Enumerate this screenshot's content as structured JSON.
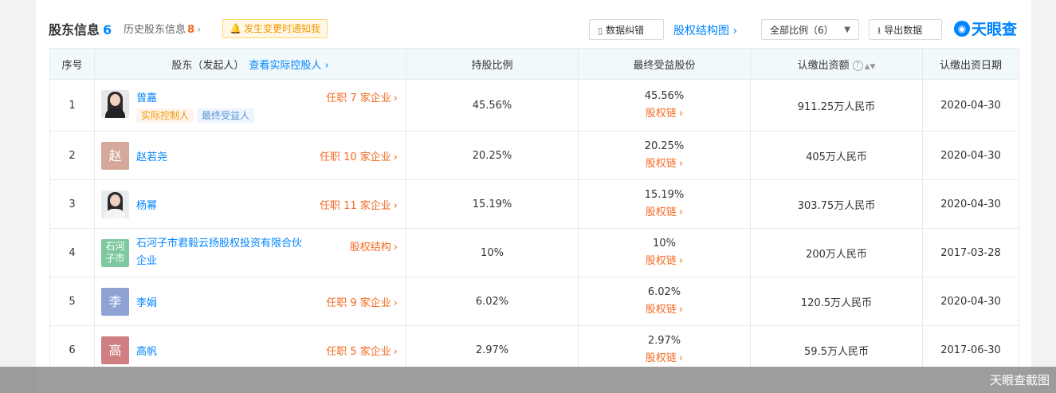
{
  "header": {
    "title": "股东信息",
    "title_count": "6",
    "history_label": "历史股东信息",
    "history_count": "8",
    "notify_label": "发生变更时通知我",
    "correct_label": "数据纠错",
    "structure_label": "股权结构图",
    "ratio_select_value": "全部比例（6）",
    "export_label": "导出数据",
    "logo_text": "天眼查"
  },
  "table": {
    "columns": {
      "index": "序号",
      "shareholder": "股东（发起人）",
      "shareholder_more": "查看实际控股人",
      "ratio": "持股比例",
      "ultimate": "最终受益股份",
      "subscribed": "认缴出资额",
      "date": "认缴出资日期"
    },
    "rows": [
      {
        "index": "1",
        "name": "曾嘉",
        "avatar": "photo",
        "jobs": "任职 7 家企业",
        "tags": [
          "实际控制人",
          "最终受益人"
        ],
        "ratio": "45.56%",
        "ultimate": "45.56%",
        "chain": "股权链",
        "subscribed": "911.25万人民币",
        "date": "2020-04-30"
      },
      {
        "index": "2",
        "name": "赵若尧",
        "avatar_text": "赵",
        "avatar_color": "#d4a99a",
        "jobs": "任职 10 家企业",
        "ratio": "20.25%",
        "ultimate": "20.25%",
        "chain": "股权链",
        "subscribed": "405万人民币",
        "date": "2020-04-30"
      },
      {
        "index": "3",
        "name": "杨幂",
        "avatar": "photo",
        "jobs": "任职 11 家企业",
        "ratio": "15.19%",
        "ultimate": "15.19%",
        "chain": "股权链",
        "subscribed": "303.75万人民币",
        "date": "2020-04-30"
      },
      {
        "index": "4",
        "name": "石河子市君毅云扬股权投资有限合伙企业",
        "avatar_text": "石河子市",
        "avatar_color": "#7fc8a0",
        "jobs": "股权结构",
        "ratio": "10%",
        "ultimate": "10%",
        "chain": "股权链",
        "subscribed": "200万人民币",
        "date": "2017-03-28"
      },
      {
        "index": "5",
        "name": "李娟",
        "avatar_text": "李",
        "avatar_color": "#8ea2d4",
        "jobs": "任职 9 家企业",
        "ratio": "6.02%",
        "ultimate": "6.02%",
        "chain": "股权链",
        "subscribed": "120.5万人民币",
        "date": "2020-04-30"
      },
      {
        "index": "6",
        "name": "高帆",
        "avatar_text": "高",
        "avatar_color": "#cf7f82",
        "jobs": "任职 5 家企业",
        "ratio": "2.97%",
        "ultimate": "2.97%",
        "chain": "股权链",
        "subscribed": "59.5万人民币",
        "date": "2017-06-30"
      }
    ]
  },
  "watermark": "天眼查截图"
}
